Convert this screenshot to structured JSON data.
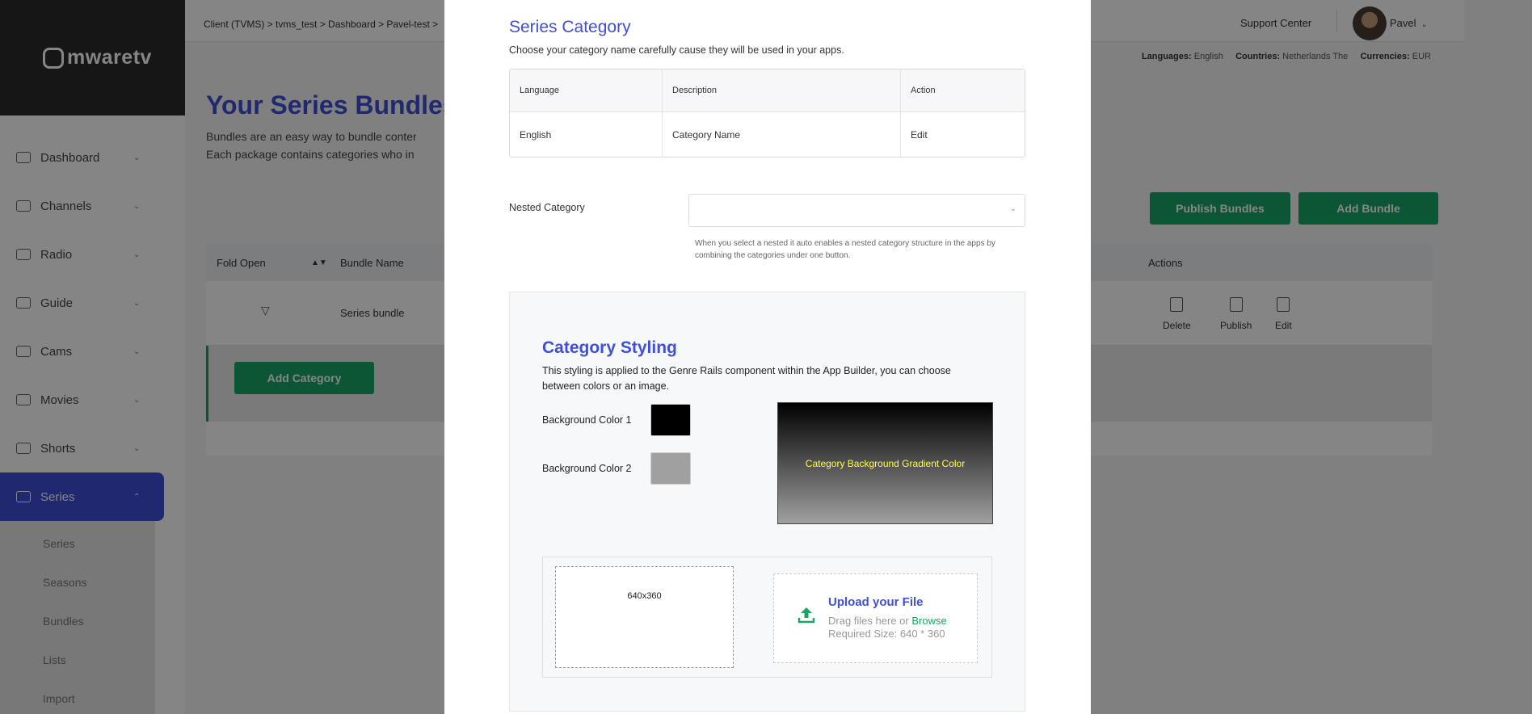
{
  "brand": {
    "logo": "mwaretv"
  },
  "sidebar": {
    "items": [
      {
        "label": "Dashboard",
        "icon": "dashboard-icon"
      },
      {
        "label": "Channels",
        "icon": "monitor-icon"
      },
      {
        "label": "Radio",
        "icon": "radio-icon"
      },
      {
        "label": "Guide",
        "icon": "grid-icon"
      },
      {
        "label": "Cams",
        "icon": "camera-icon"
      },
      {
        "label": "Movies",
        "icon": "film-icon"
      },
      {
        "label": "Shorts",
        "icon": "tv-icon"
      },
      {
        "label": "Series",
        "icon": "video-icon",
        "active": true
      }
    ],
    "subitems": [
      "Series",
      "Seasons",
      "Bundles",
      "Lists",
      "Import"
    ]
  },
  "topbar": {
    "breadcrumb": "Client (TVMS)  > tvms_test  >  Dashboard  > Pavel-test >",
    "support": "Support Center",
    "user": "Pavel"
  },
  "locale": {
    "languages_label": "Languages:",
    "languages": "English",
    "countries_label": "Countries:",
    "countries": "Netherlands The",
    "currencies_label": "Currencies:",
    "currencies": "EUR"
  },
  "page": {
    "title": "Your Series Bundles",
    "desc_line1": "Bundles are an easy way to bundle content to be",
    "desc_line2": "Each package contains categories who in return co",
    "publish_button": "Publish Bundles",
    "add_button": "Add Bundle",
    "table": {
      "col_fold": "Fold Open",
      "col_name": "Bundle Name",
      "col_actions": "Actions",
      "row_name": "Series bundle",
      "actions": [
        "Delete",
        "Publish",
        "Edit"
      ],
      "add_category": "Add Category"
    }
  },
  "modal": {
    "title": "Series Category",
    "subtitle": "Choose your category name carefully cause they will be used in your apps.",
    "table": {
      "headers": [
        "Language",
        "Description",
        "Action"
      ],
      "row": [
        "English",
        "Category Name",
        "Edit"
      ]
    },
    "nested_label": "Nested Category",
    "nested_help": "When you select a nested it auto enables a nested category structure in the apps by combining the categories under one button.",
    "styling": {
      "title": "Category Styling",
      "desc": "This styling is applied to the Genre Rails component within the App Builder, you can choose between colors or an image.",
      "bg1_label": "Background Color 1",
      "bg1_color": "#000000",
      "bg2_label": "Background Color 2",
      "bg2_color": "#a0a0a0",
      "preview_text": "Category Background Gradient Color",
      "image_size_label": "640x360",
      "upload_title": "Upload your File",
      "upload_drag": "Drag files here or",
      "upload_browse": "Browse",
      "upload_required": "Required Size: 640 * 360"
    }
  },
  "colors": {
    "accent": "#3f4fd6",
    "green": "#1aa566"
  }
}
